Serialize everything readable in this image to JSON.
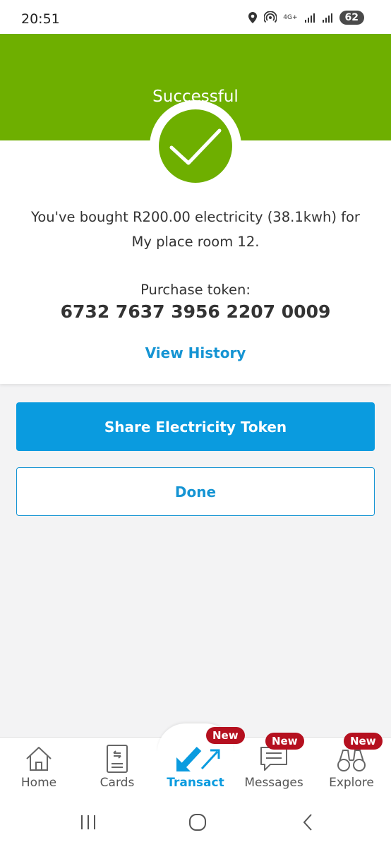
{
  "status_bar": {
    "time": "20:51",
    "network_label": "4G+",
    "battery": "62"
  },
  "header": {
    "title": "Successful",
    "color": "#6eaf00"
  },
  "result": {
    "message": "You've bought R200.00 electricity (38.1kwh) for My place room 12.",
    "token_label": "Purchase token:",
    "token_value": "6732 7637 3956 2207 0009",
    "view_history_label": "View History"
  },
  "actions": {
    "share_label": "Share Electricity Token",
    "done_label": "Done",
    "accent_color": "#0a9bdf"
  },
  "bottom_nav": {
    "items": [
      {
        "label": "Home",
        "icon": "home-icon"
      },
      {
        "label": "Cards",
        "icon": "cards-icon"
      },
      {
        "label": "Transact",
        "icon": "transact-icon",
        "badge": "New",
        "active": true
      },
      {
        "label": "Messages",
        "icon": "messages-icon",
        "badge": "New"
      },
      {
        "label": "Explore",
        "icon": "binoculars-icon",
        "badge": "New"
      }
    ],
    "badge_color": "#b5101f"
  },
  "system_nav": {
    "buttons": [
      "recents-icon",
      "home-circle-icon",
      "back-icon"
    ]
  }
}
